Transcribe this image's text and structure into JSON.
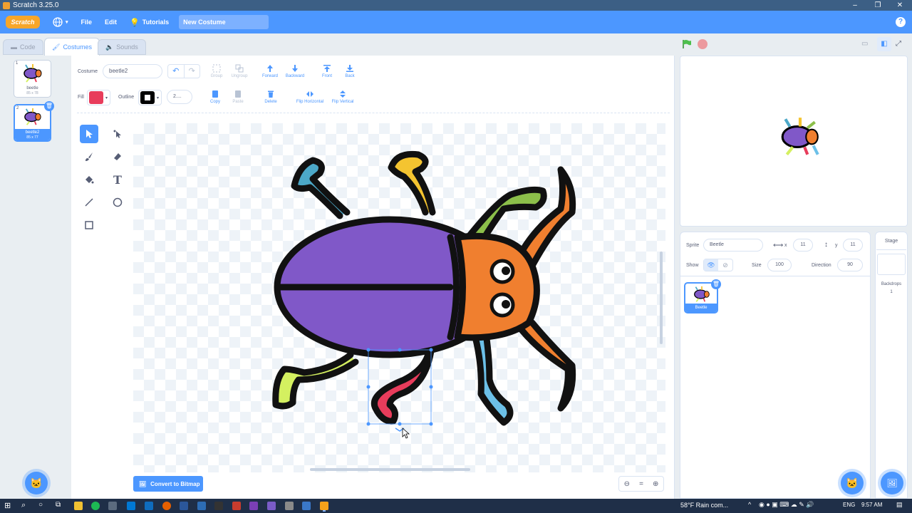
{
  "window": {
    "title": "Scratch 3.25.0"
  },
  "menubar": {
    "logo": "Scratch",
    "file": "File",
    "edit": "Edit",
    "tutorials": "Tutorials",
    "project_title": "New Costume"
  },
  "tabs": [
    {
      "label": "Code",
      "icon": "code-icon"
    },
    {
      "label": "Costumes",
      "icon": "brush-icon"
    },
    {
      "label": "Sounds",
      "icon": "speaker-icon"
    }
  ],
  "costumes": [
    {
      "index": "1",
      "name": "beetle",
      "size": "85 x 78"
    },
    {
      "index": "2",
      "name": "beetle2",
      "size": "85 x 77"
    }
  ],
  "paint": {
    "costume_label": "Costume",
    "costume_name": "beetle2",
    "fill_label": "Fill",
    "fill_color": "#e83c5b",
    "outline_label": "Outline",
    "outline_color": "#000000",
    "outline_width": "2....",
    "group": "Group",
    "ungroup": "Ungroup",
    "forward": "Forward",
    "backward": "Backward",
    "front": "Front",
    "back": "Back",
    "copy": "Copy",
    "paste": "Paste",
    "delete": "Delete",
    "flip_h": "Flip Horizontal",
    "flip_v": "Flip Vertical",
    "convert": "Convert to Bitmap"
  },
  "sprite_info": {
    "sprite_label": "Sprite",
    "sprite_name": "Beetle",
    "x_label": "x",
    "x_value": "11",
    "y_label": "y",
    "y_value": "11",
    "show_label": "Show",
    "size_label": "Size",
    "size_value": "100",
    "direction_label": "Direction",
    "direction_value": "90",
    "sprite_tile_name": "Beetle"
  },
  "stage_panel": {
    "title": "Stage",
    "backdrops_label": "Backdrops",
    "backdrops_count": "1"
  },
  "taskbar": {
    "weather": "58°F  Rain com...",
    "lang": "ENG",
    "time": "9:57 AM"
  },
  "colors": {
    "accent": "#4c97ff",
    "beetle_body": "#8058c8",
    "beetle_head": "#f07f2f"
  }
}
